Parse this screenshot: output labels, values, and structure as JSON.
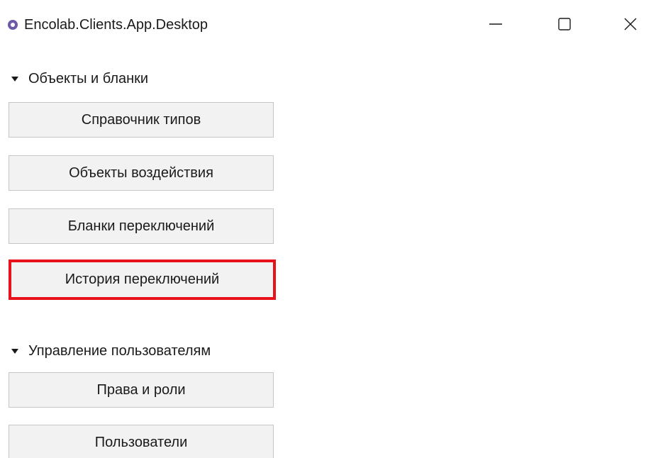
{
  "window": {
    "title": "Encolab.Clients.App.Desktop",
    "icon": "app-logo-icon",
    "controls": {
      "minimize": "minimize-icon",
      "maximize": "maximize-icon",
      "close": "close-icon"
    }
  },
  "sections": [
    {
      "title": "Объекты и бланки",
      "expanded": true,
      "buttons": [
        {
          "label": "Справочник типов"
        },
        {
          "label": "Объекты воздействия"
        },
        {
          "label": "Бланки переключений"
        },
        {
          "label": "История переключений",
          "highlighted": true,
          "highlight_color": "#e8121a"
        }
      ]
    },
    {
      "title": "Управление пользователям",
      "expanded": true,
      "buttons": [
        {
          "label": "Права и роли"
        },
        {
          "label": "Пользователи"
        }
      ]
    }
  ]
}
